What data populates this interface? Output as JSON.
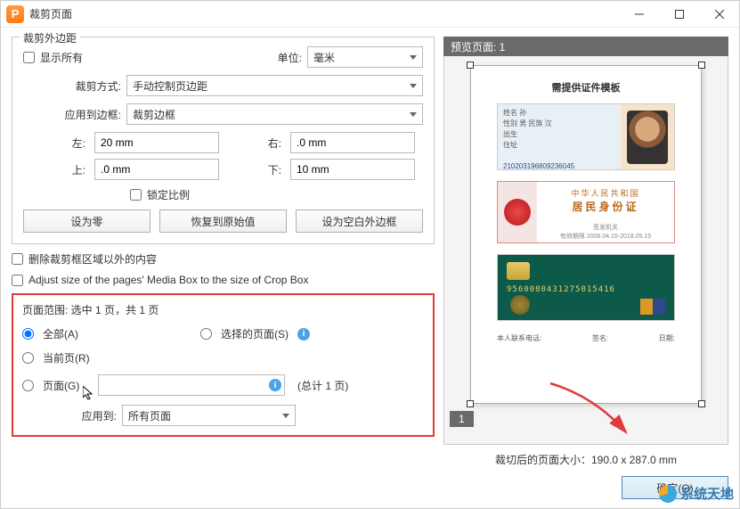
{
  "window": {
    "title": "裁剪页面"
  },
  "groupbox": {
    "margins_title": "裁剪外边距",
    "show_all": "显示所有",
    "unit_label": "单位:",
    "unit_value": "毫米",
    "crop_method_label": "裁剪方式:",
    "crop_method_value": "手动控制页边距",
    "apply_border_label": "应用到边框:",
    "apply_border_value": "裁剪边框",
    "left_label": "左:",
    "left_value": "20 mm",
    "right_label": "右:",
    "right_value": ".0 mm",
    "top_label": "上:",
    "top_value": ".0 mm",
    "bottom_label": "下:",
    "bottom_value": "10 mm",
    "lock_ratio": "锁定比例",
    "btn_zero": "设为零",
    "btn_restore": "恢复到原始值",
    "btn_blank": "设为空白外边框",
    "remove_outside": "删除裁剪框区域以外的内容",
    "adjust_media": "Adjust size of the pages' Media Box to the size of Crop Box"
  },
  "page_range": {
    "title": "页面范围: 选中 1 页，共 1 页",
    "all": "全部(A)",
    "selected": "选择的页面(S)",
    "current": "当前页(R)",
    "pages": "页面(G)",
    "total": "(总计 1 页)",
    "apply_to_label": "应用到:",
    "apply_to_value": "所有页面"
  },
  "preview": {
    "header": "预览页面: 1",
    "doc_title": "需提供证件模板",
    "id_number": "210203196809236045",
    "card2_line1": "中华人民共和国",
    "card2_line2": "居民身份证",
    "card3_number": "9560080431275015416",
    "sig_phone": "本人联系电话:",
    "sig_name": "签名:",
    "sig_date": "日期:",
    "page_tab": "1",
    "size_label": "裁切后的页面大小：190.0 x 287.0 mm"
  },
  "buttons": {
    "ok": "确定(O)"
  },
  "watermark": {
    "text": "系统天地"
  }
}
